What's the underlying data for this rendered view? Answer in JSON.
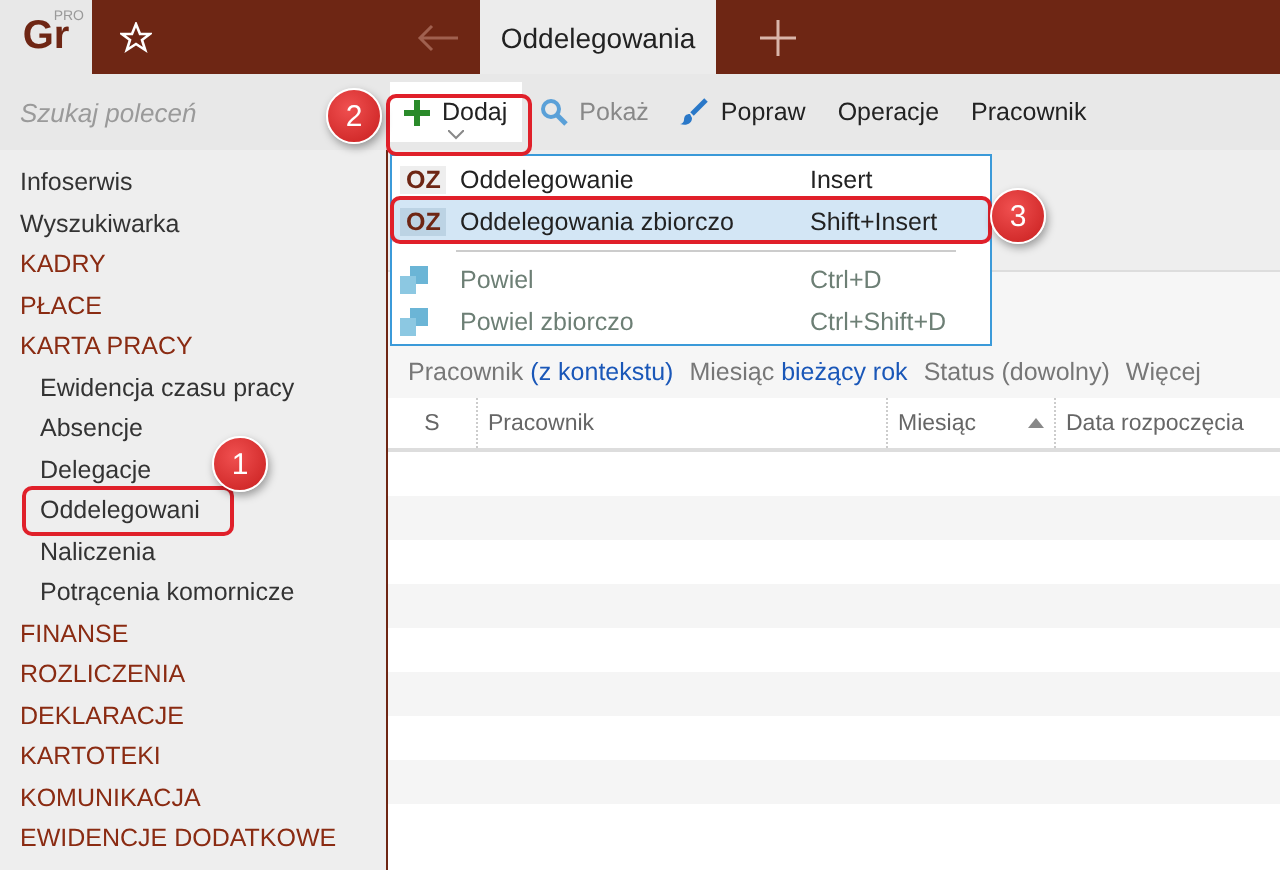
{
  "logo": {
    "text": "Gr",
    "sup": "PRO"
  },
  "tabs": [
    {
      "label": "Oddelegowania",
      "selected": true
    }
  ],
  "search": {
    "placeholder": "Szukaj poleceń"
  },
  "toolbar": [
    {
      "label": "Dodaj",
      "kind": "add",
      "disabled": false,
      "dropdown": true
    },
    {
      "label": "Pokaż",
      "kind": "show",
      "disabled": true,
      "dropdown": false
    },
    {
      "label": "Popraw",
      "kind": "edit",
      "disabled": false,
      "dropdown": false
    },
    {
      "label": "Operacje",
      "kind": "text",
      "disabled": false,
      "dropdown": false
    },
    {
      "label": "Pracownik",
      "kind": "text",
      "disabled": false,
      "dropdown": false
    }
  ],
  "sidebar": {
    "items": [
      {
        "label": "Infoserwis",
        "kind": "link"
      },
      {
        "label": "Wyszukiwarka",
        "kind": "link"
      },
      {
        "label": "KADRY",
        "kind": "section"
      },
      {
        "label": "PŁACE",
        "kind": "section"
      },
      {
        "label": "KARTA PRACY",
        "kind": "section",
        "children": [
          {
            "label": "Ewidencja czasu pracy"
          },
          {
            "label": "Absencje"
          },
          {
            "label": "Delegacje"
          },
          {
            "label": "Oddelegowani"
          },
          {
            "label": "Naliczenia"
          },
          {
            "label": "Potrącenia komornicze"
          }
        ]
      },
      {
        "label": "FINANSE",
        "kind": "section"
      },
      {
        "label": "ROZLICZENIA",
        "kind": "section"
      },
      {
        "label": "DEKLARACJE",
        "kind": "section"
      },
      {
        "label": "KARTOTEKI",
        "kind": "section"
      },
      {
        "label": "KOMUNIKACJA",
        "kind": "section"
      },
      {
        "label": "EWIDENCJE DODATKOWE",
        "kind": "section"
      }
    ]
  },
  "menu": [
    {
      "kind": "item",
      "badge": "OZ",
      "label": "Oddelegowanie",
      "shortcut": "Insert",
      "selected": false,
      "disabled": false
    },
    {
      "kind": "item",
      "badge": "OZ",
      "label": "Oddelegowania zbiorczo",
      "shortcut": "Shift+Insert",
      "selected": true,
      "disabled": false
    },
    {
      "kind": "separator"
    },
    {
      "kind": "copy",
      "label": "Powiel",
      "shortcut": "Ctrl+D",
      "selected": false,
      "disabled": true
    },
    {
      "kind": "copy",
      "label": "Powiel zbiorczo",
      "shortcut": "Ctrl+Shift+D",
      "selected": false,
      "disabled": true
    }
  ],
  "filters": [
    {
      "label": "Pracownik",
      "value": "(z kontekstu)",
      "set": true
    },
    {
      "label": "Miesiąc",
      "value": "bieżący rok",
      "set": true
    },
    {
      "label": "Status",
      "value": "(dowolny)",
      "set": false
    },
    {
      "label": "Więcej"
    }
  ],
  "table": {
    "columns": [
      {
        "label": "S",
        "sorted": false
      },
      {
        "label": "Pracownik",
        "sorted": false
      },
      {
        "label": "Miesiąc",
        "sorted": true
      },
      {
        "label": "Data rozpoczęcia",
        "sorted": false
      }
    ]
  },
  "callouts": [
    {
      "label": "1"
    },
    {
      "label": "2"
    },
    {
      "label": "3"
    }
  ]
}
